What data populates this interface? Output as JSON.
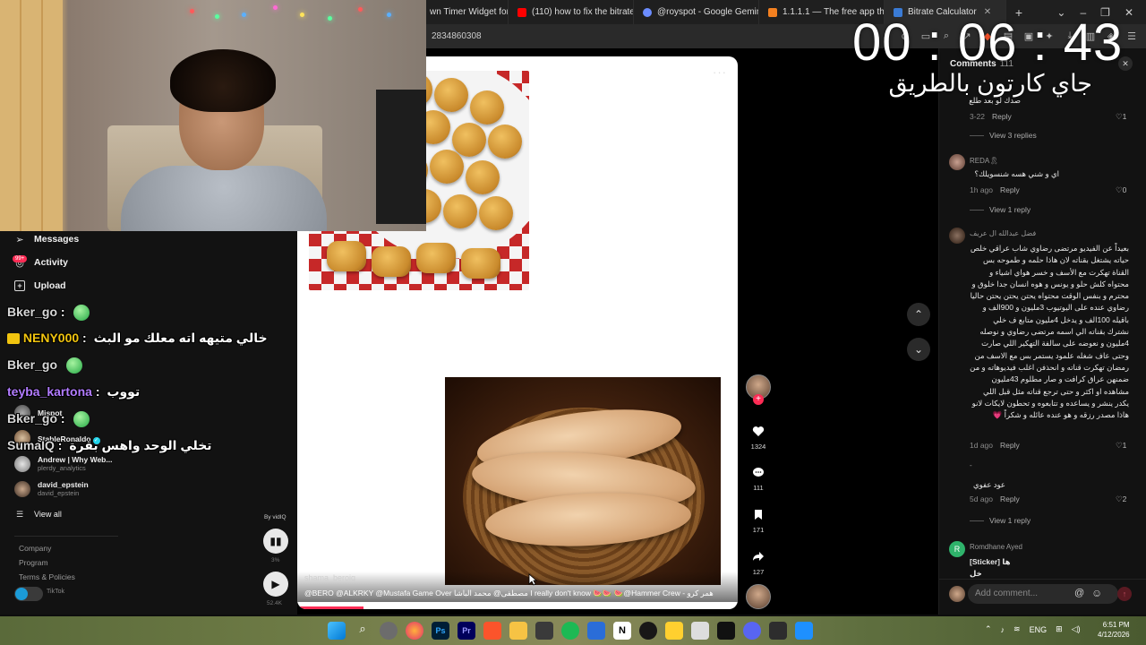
{
  "browser": {
    "tabs": [
      {
        "label": "wn Timer Widget for",
        "color": "#2f7dd8"
      },
      {
        "label": "(110) how to fix the bitrate on",
        "color": "#ff0000"
      },
      {
        "label": "@royspot - Google Gemini",
        "color": "#6b8cff"
      },
      {
        "label": "1.1.1.1 — The free app that m",
        "color": "#f38020"
      },
      {
        "label": "Bitrate Calculator",
        "color": "#3a7bd5"
      }
    ],
    "url": "2834860308"
  },
  "timer": {
    "value": "00 : 06 : 43",
    "subtitle": "جاي كارتون بالطريق"
  },
  "video": {
    "watermark": "shama_beroiq",
    "caption": "@BERO @ALKRKY @Mustafa Game Over مصطفى@ محمد الباشا I really don't know 🍉🍉 🍉@Hammer Crew - همر كرو",
    "progress": 0.15
  },
  "actions": {
    "likes": "1324",
    "comments": "111",
    "saves": "171",
    "shares": "127"
  },
  "comments": {
    "title": "Comments",
    "count": "111",
    "items": [
      {
        "text": "صدك لو بعد طلع",
        "time": "3-22",
        "reply": "Reply",
        "likes": "1",
        "view_replies": "View 3 replies"
      },
      {
        "user": "REDA🎗",
        "text": "اي و شني هسه شنسويلك؟",
        "time": "1h ago",
        "reply": "Reply",
        "likes": "0",
        "view_replies": "View 1 reply"
      },
      {
        "user": "فضل عبدالله ال عريف",
        "text": "بعيداً عن الفيديو مرتضى رضاوي شاب عراقي خلص حياته يشتغل بقناته لان هاذا حلمه و طموحه بس القناة تهكرت مع الأسف و خسر هواي اشياء و محتواه كلش حلو و يونس و هوه انسان جدا خلوق و محترم و بنفس الوقت محتواه يحتن يحتن يحتن حاليا رضاوي عنده على اليوتيوب 3مليون و 900الف و باقيله 100الف و يدخل 4مليون متابع ف خلي نشترك بقناته الي اسمه مرتضى رضاوي و نوصله 4مليون و نعوضه على سالفة التهكير اللي صارت وحتى عاف شغله علمود يستمر بس مع الاسف من رمضان تهكرت قناته و انحذفن اغلب فيديوهاته و من ضمنهن عراق كرافت و صار مطلوم 43مليون مشاهده او اكثر و حتى ترجع قناته مثل قبل اللي يكدر ينشر و يساعده و تتابعوه و تحطون لايكات لانو هاذا مصدر رزقه و هو عنده عائله و شكراً 💗",
        "time": "1d ago",
        "reply": "Reply",
        "likes": "1"
      },
      {
        "user": "-",
        "text": "عود عفوي",
        "time": "5d ago",
        "reply": "Reply",
        "likes": "2",
        "view_replies": "View 1 reply"
      },
      {
        "user": "Romdhane Ayed",
        "avatar_letter": "R",
        "text": "[Sticker] ها خل",
        "time": ""
      }
    ],
    "input_placeholder": "Add comment..."
  },
  "sidebar": {
    "items": [
      {
        "label": "Messages",
        "icon": "paper-plane-icon"
      },
      {
        "label": "Activity",
        "icon": "bell-icon",
        "badge": "99+"
      },
      {
        "label": "Upload",
        "icon": "plus-square-icon"
      }
    ],
    "following": [
      {
        "name": "Mjspot",
        "handle": ""
      },
      {
        "name": "StableRonaldo",
        "handle": "",
        "verified": true
      },
      {
        "name": "Andrew | Why Web...",
        "handle": "plerdy_analytics"
      },
      {
        "name": "david_epstein",
        "handle": "david_epstein"
      }
    ],
    "view_all": "View all",
    "footer": [
      "Company",
      "Program",
      "Terms & Policies"
    ],
    "footer_small": "TikTok"
  },
  "chat": [
    {
      "user": "Bker_go",
      "sep": ":",
      "msg": "",
      "color": "#d8d8d8",
      "emote": true
    },
    {
      "user": "NENY000",
      "sep": ":",
      "msg": "خالي متيهه اته معلك مو البث",
      "color": "#f1c40f"
    },
    {
      "user": "Bker_go",
      "sep": ":",
      "msg": "",
      "color": "#d8d8d8",
      "emote": true
    },
    {
      "user": "teyba_kartona",
      "sep": ":",
      "msg": "تووب",
      "color": "#b27cff"
    },
    {
      "user": "Bker_go",
      "sep": ":",
      "msg": "",
      "color": "#d8d8d8",
      "emote": true
    },
    {
      "user": "SumaIQ",
      "sep": ":",
      "msg": "تخلي الوحد واهس بقرة",
      "color": "#d8d8d8"
    }
  ],
  "vidiq": {
    "by": "By vidIQ",
    "pct": "3%",
    "views": "52.4K"
  },
  "taskbar": {
    "lang": "ENG",
    "time": "6:51 PM",
    "date": "4/12/2026"
  },
  "colors": {
    "accent": "#fe2c55",
    "panel": "#121212"
  }
}
